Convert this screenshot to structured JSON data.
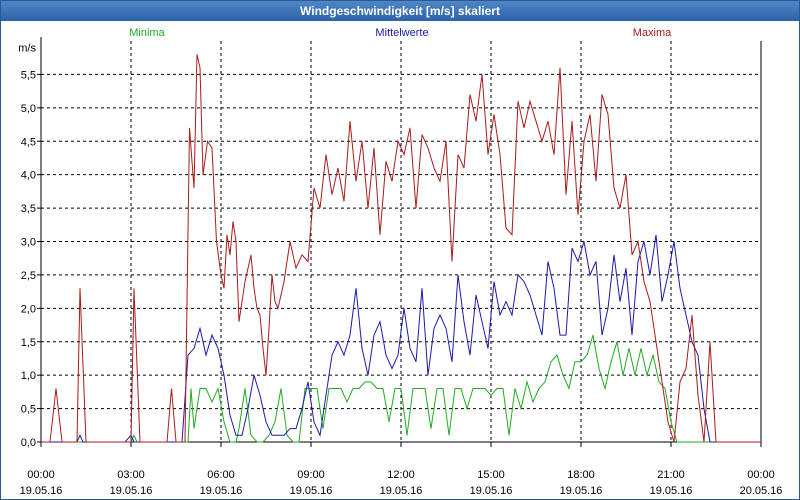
{
  "window": {
    "title": "Windgeschwindigkeit [m/s] skaliert"
  },
  "chart_data": {
    "type": "line",
    "title": "Windgeschwindigkeit [m/s] skaliert",
    "ylabel": "m/s",
    "ylim": [
      0,
      6
    ],
    "yticks": [
      "0,0",
      "0,5",
      "1,0",
      "1,5",
      "2,0",
      "2,5",
      "3,0",
      "3,5",
      "4,0",
      "4,5",
      "5,0",
      "5,5"
    ],
    "xlim": [
      0,
      24
    ],
    "xticks": [
      {
        "time": "00:00",
        "date": "19.05.16"
      },
      {
        "time": "03:00",
        "date": "19.05.16"
      },
      {
        "time": "06:00",
        "date": "19.05.16"
      },
      {
        "time": "09:00",
        "date": "19.05.16"
      },
      {
        "time": "12:00",
        "date": "19.05.16"
      },
      {
        "time": "15:00",
        "date": "19.05.16"
      },
      {
        "time": "18:00",
        "date": "19.05.16"
      },
      {
        "time": "21:00",
        "date": "19.05.16"
      },
      {
        "time": "00:00",
        "date": "20.05.16"
      }
    ],
    "grid": true,
    "legend_position": "top",
    "series": [
      {
        "name": "Minima",
        "color": "#22aa22",
        "x": [
          0,
          3,
          3.1,
          3.2,
          4.9,
          5.0,
          5.1,
          5.3,
          5.5,
          5.7,
          5.9,
          6.1,
          6.3,
          6.5,
          6.6,
          6.8,
          7.0,
          7.2,
          7.4,
          7.6,
          7.8,
          8.0,
          8.2,
          8.4,
          8.6,
          8.8,
          9.0,
          9.2,
          9.4,
          9.6,
          9.8,
          10.0,
          10.2,
          10.4,
          10.6,
          10.8,
          11.0,
          11.2,
          11.4,
          11.6,
          11.8,
          12.0,
          12.2,
          12.4,
          12.6,
          12.8,
          13.0,
          13.2,
          13.4,
          13.6,
          13.8,
          14.0,
          14.2,
          14.4,
          14.6,
          14.8,
          15.0,
          15.2,
          15.4,
          15.6,
          15.8,
          16.0,
          16.2,
          16.4,
          16.6,
          16.8,
          17.0,
          17.2,
          17.4,
          17.6,
          17.8,
          18.0,
          18.2,
          18.4,
          18.6,
          18.8,
          19.0,
          19.2,
          19.4,
          19.6,
          19.8,
          20.0,
          20.2,
          20.4,
          20.6,
          20.8,
          21.0,
          21.2,
          21.4,
          24
        ],
        "y": [
          0,
          0,
          0.1,
          0,
          0,
          0.8,
          0.2,
          0.8,
          0.8,
          0.6,
          0.8,
          0.3,
          0,
          0,
          0.2,
          0.8,
          0.1,
          0,
          0,
          0.1,
          0.3,
          0.8,
          0.1,
          0,
          0,
          0.8,
          0.8,
          0.8,
          0.2,
          0.8,
          0.8,
          0.8,
          0.6,
          0.8,
          0.8,
          0.9,
          0.9,
          0.8,
          0.8,
          0.3,
          0.8,
          0.8,
          0.1,
          0.8,
          0.8,
          0.8,
          0.2,
          0.8,
          0.8,
          0.1,
          0.8,
          0.8,
          0.5,
          0.8,
          0.8,
          0.8,
          0.7,
          0.8,
          0.8,
          0.1,
          0.8,
          0.5,
          0.9,
          0.6,
          0.8,
          0.9,
          1.2,
          1.3,
          1,
          0.8,
          1.2,
          1.2,
          1.3,
          1.6,
          1.1,
          0.8,
          1.2,
          1.5,
          1.0,
          1.4,
          1.0,
          1.4,
          1.0,
          1.3,
          0.9,
          0.8,
          0.3,
          0,
          0,
          0
        ]
      },
      {
        "name": "Mittelwerte",
        "color": "#1a1aa8",
        "x": [
          0,
          1.2,
          1.3,
          1.4,
          2.8,
          3.0,
          3.1,
          4.7,
          4.9,
          5.1,
          5.3,
          5.5,
          5.7,
          5.9,
          6.1,
          6.3,
          6.5,
          6.7,
          6.9,
          7.1,
          7.3,
          7.5,
          7.7,
          7.9,
          8.1,
          8.3,
          8.5,
          8.7,
          8.9,
          9.1,
          9.3,
          9.5,
          9.7,
          9.9,
          10.1,
          10.3,
          10.5,
          10.7,
          10.9,
          11.1,
          11.3,
          11.5,
          11.7,
          11.9,
          12.1,
          12.3,
          12.5,
          12.7,
          12.9,
          13.1,
          13.3,
          13.5,
          13.7,
          13.9,
          14.1,
          14.3,
          14.5,
          14.7,
          14.9,
          15.1,
          15.3,
          15.5,
          15.7,
          15.9,
          16.1,
          16.3,
          16.5,
          16.7,
          16.9,
          17.1,
          17.3,
          17.5,
          17.7,
          17.9,
          18.1,
          18.3,
          18.5,
          18.7,
          18.9,
          19.1,
          19.3,
          19.5,
          19.7,
          19.9,
          20.1,
          20.3,
          20.5,
          20.7,
          20.9,
          21.1,
          21.3,
          21.5,
          21.7,
          21.9,
          22.1,
          22.3,
          24
        ],
        "y": [
          0,
          0,
          0.1,
          0,
          0,
          0.1,
          0,
          0,
          1.3,
          1.4,
          1.7,
          1.3,
          1.6,
          1.4,
          1.0,
          0.4,
          0.1,
          0.1,
          0.5,
          1.0,
          0.7,
          0.3,
          0.1,
          0.1,
          0.1,
          0.2,
          0.2,
          0.5,
          0.9,
          0.3,
          0.1,
          0.7,
          1.3,
          1.5,
          1.3,
          1.6,
          2.3,
          1.4,
          1.0,
          1.6,
          1.8,
          1.3,
          1.1,
          1.3,
          2.0,
          1.4,
          1.2,
          2.3,
          1.0,
          1.7,
          1.9,
          1.7,
          1.2,
          2.5,
          1.8,
          1.3,
          2.2,
          1.8,
          1.4,
          2.4,
          1.9,
          2.1,
          1.9,
          2.5,
          2.4,
          2.2,
          1.9,
          1.6,
          2.7,
          2.3,
          1.6,
          1.6,
          2.9,
          2.7,
          3.0,
          2.5,
          2.7,
          1.6,
          2.0,
          2.8,
          2.1,
          2.6,
          1.6,
          2.7,
          3.0,
          2.5,
          3.1,
          2.1,
          2.5,
          3.0,
          2.3,
          1.9,
          1.5,
          1.3,
          0.5,
          0,
          0
        ]
      },
      {
        "name": "Maxima",
        "color": "#aa1a1a",
        "x": [
          0,
          0.3,
          0.5,
          0.7,
          1.2,
          1.3,
          1.5,
          3.0,
          3.1,
          3.3,
          4.2,
          4.35,
          4.5,
          4.8,
          4.95,
          5.1,
          5.2,
          5.3,
          5.4,
          5.55,
          5.7,
          5.85,
          6.0,
          6.1,
          6.2,
          6.3,
          6.4,
          6.5,
          6.6,
          6.7,
          6.8,
          6.9,
          7.0,
          7.1,
          7.2,
          7.3,
          7.4,
          7.5,
          7.6,
          7.7,
          7.8,
          7.9,
          8.1,
          8.3,
          8.5,
          8.7,
          8.9,
          9.1,
          9.3,
          9.5,
          9.7,
          9.9,
          10.1,
          10.3,
          10.5,
          10.7,
          10.9,
          11.1,
          11.3,
          11.5,
          11.7,
          11.9,
          12.1,
          12.3,
          12.5,
          12.7,
          12.9,
          13.1,
          13.3,
          13.5,
          13.7,
          13.9,
          14.1,
          14.3,
          14.5,
          14.7,
          14.9,
          15.1,
          15.3,
          15.5,
          15.7,
          15.9,
          16.1,
          16.3,
          16.5,
          16.7,
          16.9,
          17.1,
          17.3,
          17.5,
          17.7,
          17.9,
          18.1,
          18.3,
          18.5,
          18.7,
          18.9,
          19.1,
          19.3,
          19.5,
          19.7,
          19.9,
          20.1,
          20.3,
          20.5,
          20.7,
          20.9,
          21.1,
          21.3,
          21.5,
          21.7,
          21.9,
          22.1,
          22.3,
          22.5,
          24
        ],
        "y": [
          0,
          0,
          0.8,
          0,
          0,
          2.3,
          0,
          0,
          2.3,
          0,
          0,
          0.8,
          0,
          0,
          4.7,
          3.8,
          5.8,
          5.6,
          4.0,
          4.5,
          4.4,
          3.0,
          2.5,
          2.3,
          3.1,
          2.8,
          3.3,
          3.0,
          1.8,
          2.1,
          2.4,
          2.6,
          2.8,
          2.3,
          2.0,
          1.9,
          1.4,
          1.0,
          1.7,
          2.5,
          2.1,
          2.0,
          2.4,
          3.0,
          2.6,
          2.8,
          2.7,
          3.8,
          3.5,
          4.3,
          3.7,
          4.1,
          3.6,
          4.8,
          3.9,
          4.5,
          3.5,
          4.4,
          3.1,
          4.2,
          3.9,
          4.5,
          4.3,
          4.7,
          3.5,
          4.6,
          4.4,
          4.1,
          3.9,
          4.5,
          2.7,
          4.3,
          4.1,
          5.2,
          4.8,
          5.5,
          4.3,
          4.9,
          4.3,
          3.2,
          3.1,
          5.1,
          4.7,
          5.1,
          4.8,
          4.5,
          4.8,
          4.3,
          5.6,
          3.7,
          4.8,
          3.4,
          4.5,
          4.9,
          3.9,
          5.2,
          4.9,
          3.8,
          3.5,
          4.0,
          2.8,
          3.0,
          2.4,
          2.1,
          1.5,
          0.9,
          0.3,
          0,
          0.9,
          1.1,
          1.9,
          0.7,
          0,
          1.5,
          0,
          0
        ]
      }
    ]
  }
}
